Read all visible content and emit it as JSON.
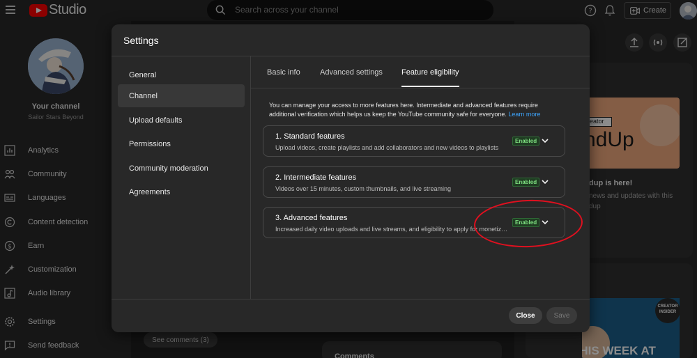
{
  "header": {
    "logo_text": "Studio",
    "search_placeholder": "Search across your channel",
    "create_label": "Create"
  },
  "sidebar": {
    "your_channel": "Your channel",
    "channel_name": "Sailor Stars Beyond",
    "items": [
      {
        "label": "Analytics",
        "icon": "analytics-icon"
      },
      {
        "label": "Community",
        "icon": "community-icon"
      },
      {
        "label": "Languages",
        "icon": "languages-icon"
      },
      {
        "label": "Content detection",
        "icon": "copyright-icon"
      },
      {
        "label": "Earn",
        "icon": "earn-icon"
      },
      {
        "label": "Customization",
        "icon": "customization-icon"
      },
      {
        "label": "Audio library",
        "icon": "audio-library-icon"
      },
      {
        "label": "Settings",
        "icon": "gear-icon"
      },
      {
        "label": "Send feedback",
        "icon": "feedback-icon"
      }
    ]
  },
  "background": {
    "card_title": "reator",
    "card_text": "ndUp",
    "news_title": "dup is here!",
    "news_line1": "news and updates with this",
    "news_line2": "dup",
    "see_comments": "See comments (3)",
    "comments_label": "Comments",
    "creator_badge": "CREATOR INSIDER",
    "video_caption": "THIS WEEK AT"
  },
  "dialog": {
    "title": "Settings",
    "nav": [
      {
        "label": "General",
        "active": false
      },
      {
        "label": "Channel",
        "active": true
      },
      {
        "label": "Upload defaults",
        "active": false
      },
      {
        "label": "Permissions",
        "active": false
      },
      {
        "label": "Community moderation",
        "active": false
      },
      {
        "label": "Agreements",
        "active": false
      }
    ],
    "tabs": [
      {
        "label": "Basic info",
        "active": false
      },
      {
        "label": "Advanced settings",
        "active": false
      },
      {
        "label": "Feature eligibility",
        "active": true
      }
    ],
    "description": "You can manage your access to more features here. Intermediate and advanced features require additional verification which helps us keep the YouTube community safe for everyone.",
    "learn_more": "Learn more",
    "features": [
      {
        "title": "1. Standard features",
        "subtitle": "Upload videos, create playlists and add collaborators and new videos to playlists",
        "status": "Enabled"
      },
      {
        "title": "2. Intermediate features",
        "subtitle": "Videos over 15 minutes, custom thumbnails, and live streaming",
        "status": "Enabled"
      },
      {
        "title": "3. Advanced features",
        "subtitle": "Increased daily video uploads and live streams, and eligibility to apply for monetization",
        "status": "Enabled"
      }
    ],
    "close_label": "Close",
    "save_label": "Save"
  },
  "colors": {
    "enabled_badge_text": "#7fe081",
    "enabled_badge_bg": "#1f3d22",
    "link": "#3ea6ff",
    "annotation": "#e0101f"
  }
}
